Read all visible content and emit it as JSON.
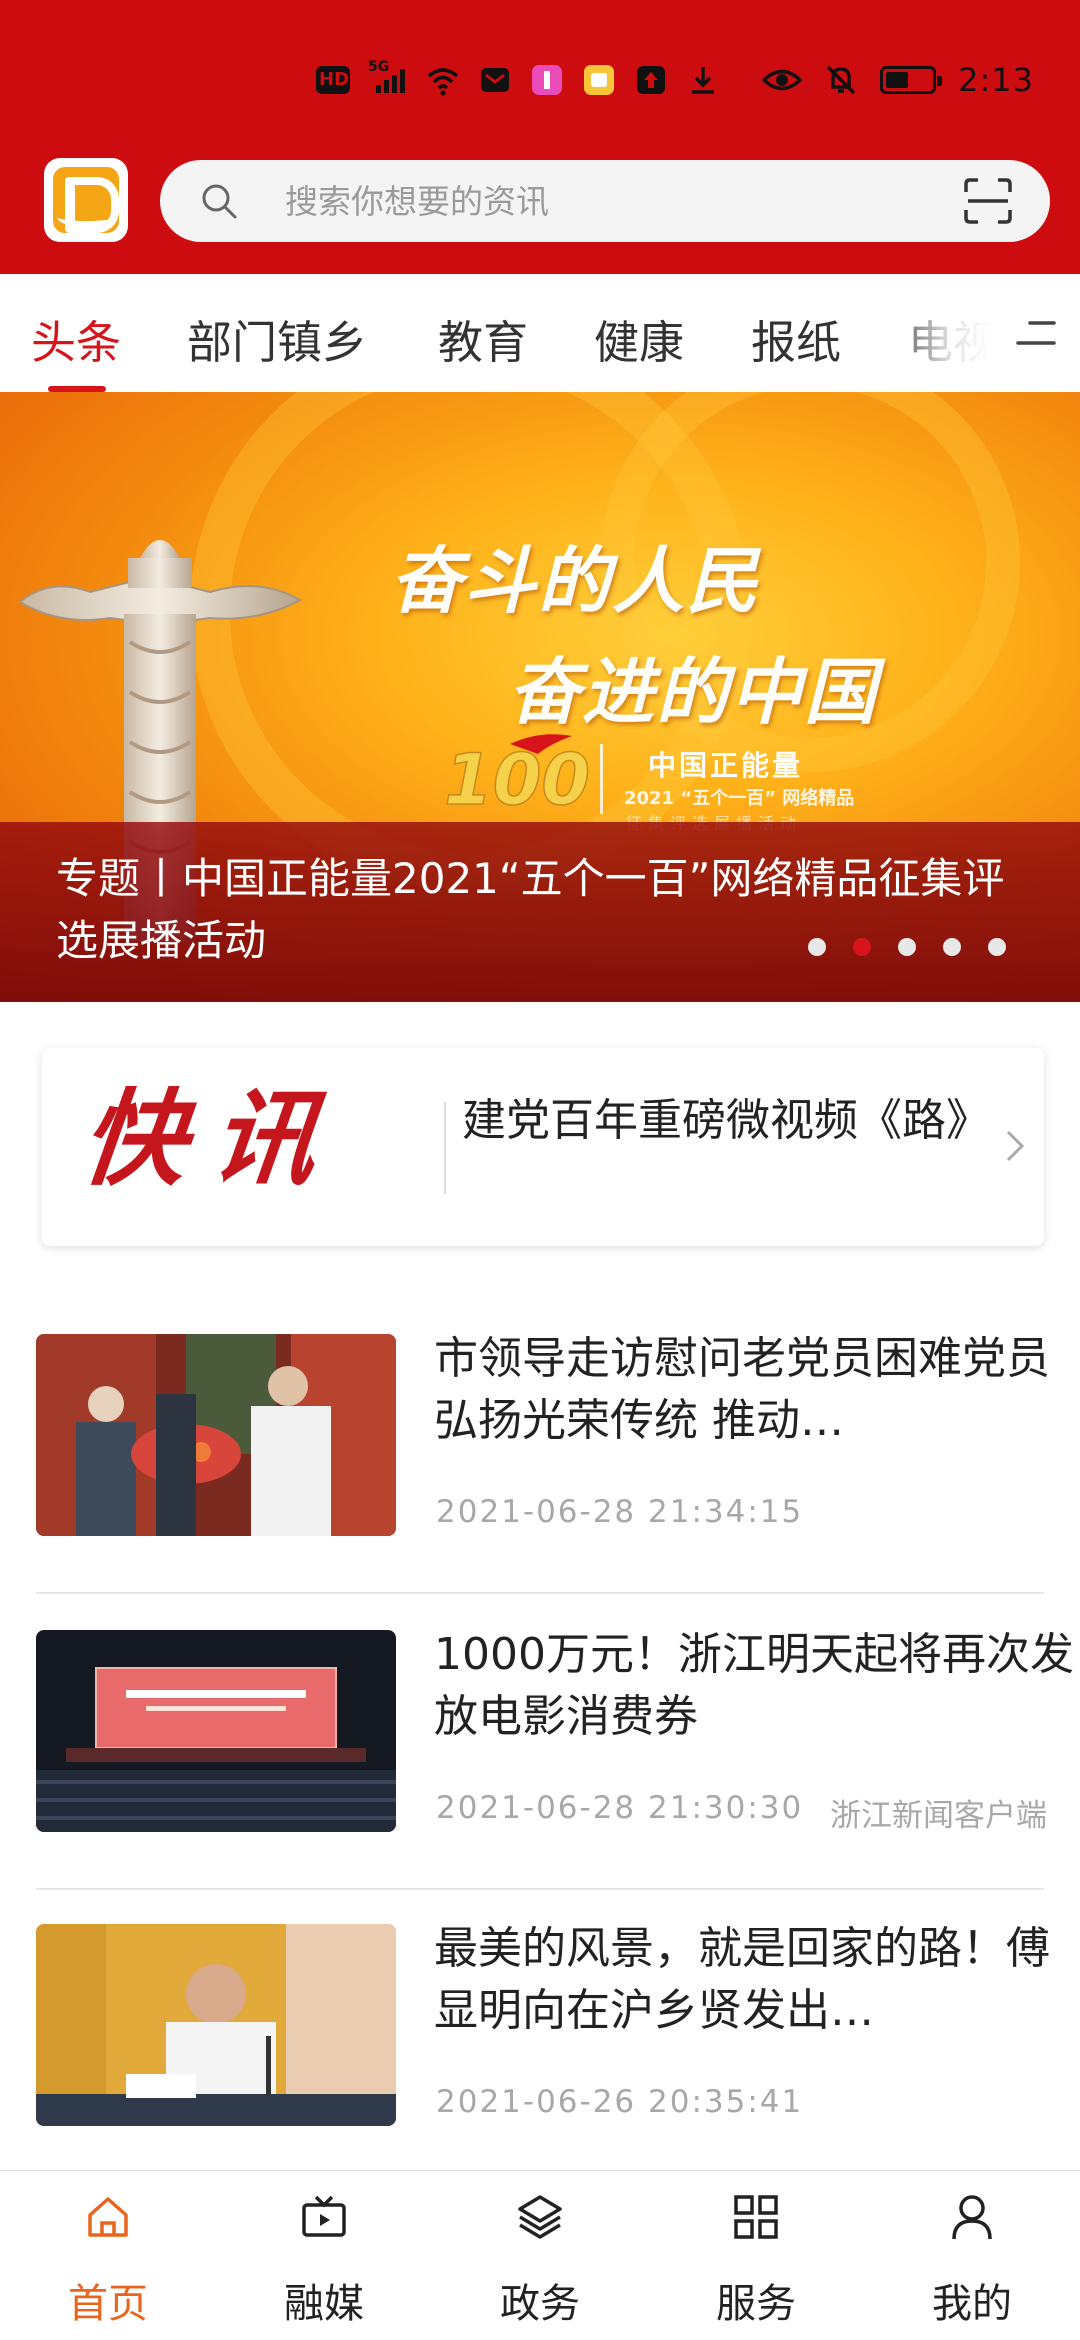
{
  "status_bar": {
    "time": "2:13",
    "left_icons": [
      "hd-icon",
      "signal-5g-icon",
      "wifi-icon",
      "message-app-icon",
      "app-icon-1",
      "app-icon-2",
      "upload-app-icon",
      "download-icon"
    ],
    "right_icons": [
      "eye-icon",
      "mute-icon",
      "battery-icon"
    ]
  },
  "header": {
    "search_placeholder": "搜索你想要的资讯",
    "accent_color": "#cc0c0f"
  },
  "tabs": {
    "items": [
      {
        "label": "头条",
        "active": true
      },
      {
        "label": "部门镇乡",
        "active": false
      },
      {
        "label": "教育",
        "active": false
      },
      {
        "label": "健康",
        "active": false
      },
      {
        "label": "报纸",
        "active": false
      },
      {
        "label": "电视",
        "active": false
      }
    ]
  },
  "banner": {
    "slogan_line1": "奋斗的人民",
    "slogan_line2": "奋进的中国",
    "badge_title": "中国正能量",
    "badge_sub": "2021 “五个一百” 网络精品",
    "badge_sub2": "征集评选展播活动",
    "caption": "专题丨中国正能量2021“五个一百”网络精品征集评选展播活动",
    "slide_count": 5,
    "active_slide": 2
  },
  "flash": {
    "logo_text": "快讯",
    "headline": "建党百年重磅微视频《路》"
  },
  "news": [
    {
      "title": "市领导走访慰问老党员困难党员　弘扬光荣传统  推动…",
      "date": "2021-06-28  21:34:15",
      "source": ""
    },
    {
      "title": "1000万元！浙江明天起将再次发放电影消费券",
      "date": "2021-06-28  21:30:30",
      "source": "浙江新闻客户端"
    },
    {
      "title": "最美的风景，就是回家的路！傅显明向在沪乡贤发出…",
      "date": "2021-06-26  20:35:41",
      "source": ""
    }
  ],
  "bottom_nav": {
    "items": [
      {
        "label": "首页",
        "icon": "home-icon",
        "active": true
      },
      {
        "label": "融媒",
        "icon": "tv-icon",
        "active": false
      },
      {
        "label": "政务",
        "icon": "layers-icon",
        "active": false
      },
      {
        "label": "服务",
        "icon": "grid-icon",
        "active": false
      },
      {
        "label": "我的",
        "icon": "user-icon",
        "active": false
      }
    ],
    "active_color": "#e9641c"
  }
}
